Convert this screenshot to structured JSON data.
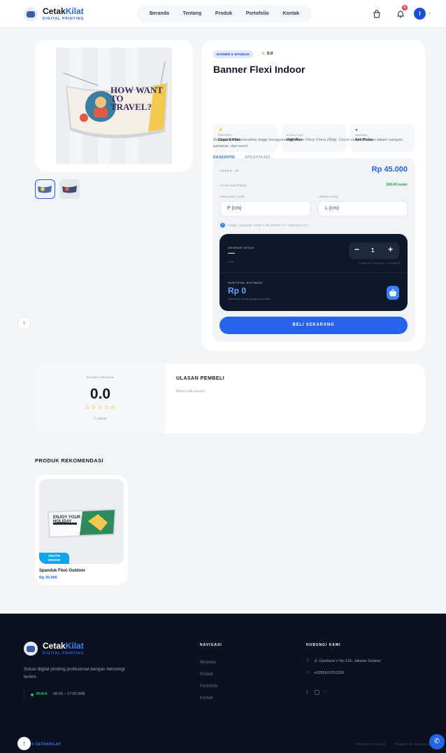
{
  "header": {
    "brand_part1": "Cetak",
    "brand_part2": "Kilat",
    "tagline": "DIGITAL PRINTING",
    "nav": [
      "Beranda",
      "Tentang",
      "Produk",
      "Portofolio",
      "Kontak"
    ],
    "notification_count": "0",
    "avatar_initial": "I"
  },
  "product": {
    "category": "BANNER & SPANDUK",
    "rating": "0.0",
    "name": "Banner Flexi Indoor",
    "features": [
      {
        "label": "PROSES",
        "value": "Cepat & Kilat",
        "icon": "lightning-icon"
      },
      {
        "label": "KUALITAS",
        "value": "High-Res",
        "icon": "quality-icon"
      },
      {
        "label": "WARNA",
        "value": "Anti Pudar",
        "icon": "palette-icon"
      }
    ],
    "tabs": [
      "DESKRIPSI",
      "SPESIFIKASI"
    ],
    "description": "Banner indoor berkualitas tinggi menggunakan bahan Flexy China 280gr. Cocok untuk dekorasi dalam ruangan, pameran, dan event.",
    "banner_text": "HOW WANT TO TRAVEL?"
  },
  "order": {
    "price_label": "HARGA / M²",
    "price": "Rp 45.000",
    "stock_label": "STOK MATERIAL",
    "stock": "500.00 meter",
    "length_label": "PANJANG (CM)",
    "length_placeholder": "P (cm)",
    "width_label": "LEBAR (CM)",
    "width_placeholder": "L (cm)",
    "hint": "Harga = panjang × lebar × Rp 45.000 / m². Minimum 1 m².",
    "size_label": "UKURAN CETAK",
    "size_value": "—",
    "size_unit": "0 m²",
    "quantity": "1",
    "qty_label": "JUMLAH PRODUK / LEMBAR",
    "subtotal_label": "SUBTOTAL ESTIMASI",
    "subtotal": "Rp 0",
    "subtotal_hint": "Masukkan ukuran panjang dan lebar",
    "buy_button": "BELI SEKARANG"
  },
  "reviews": {
    "rating_label": "RATING PRODUK",
    "rating_value": "0.0",
    "stars": "☆☆☆☆☆",
    "count": "0 ulasan",
    "title": "ULASAN PEMBELI",
    "empty": "Belum ada ulasan."
  },
  "recommendations": {
    "title": "PRODUK REKOMENDASI",
    "items": [
      {
        "name": "Spanduk Flexi Outdoor",
        "price": "Rp 35.000",
        "badge_line1": "GRATIS",
        "badge_line2": "ONGKIR",
        "banner_text": "ENJOY YOUR HOLIDAY"
      }
    ]
  },
  "footer": {
    "brand_part1": "Cetak",
    "brand_part2": "Kilat",
    "tagline": "DIGITAL PRINTING",
    "about": "Solusi digital printing profesional dengan teknologi terkini.",
    "status": "BUKA",
    "hours": "08:00 – 17:00 WIB",
    "nav_title": "NAVIGASI",
    "nav_links": [
      "Beranda",
      "Produk",
      "Portofolio",
      "Kontak"
    ],
    "contact_title": "HUBUNGI KAMI",
    "address": "Jl. Gandaria V No.11E, Jakarta Selatan",
    "phone": "+6285810761209",
    "copyright": "© CETAKKILAT",
    "privacy": "PRIVACY POLICY",
    "terms": "TERMS OF SERVICE"
  },
  "colors": {
    "accent": "#2563eb",
    "dark_panel": "#0f172a",
    "footer_bg": "#0b1120",
    "stock_green": "#16a34a"
  }
}
